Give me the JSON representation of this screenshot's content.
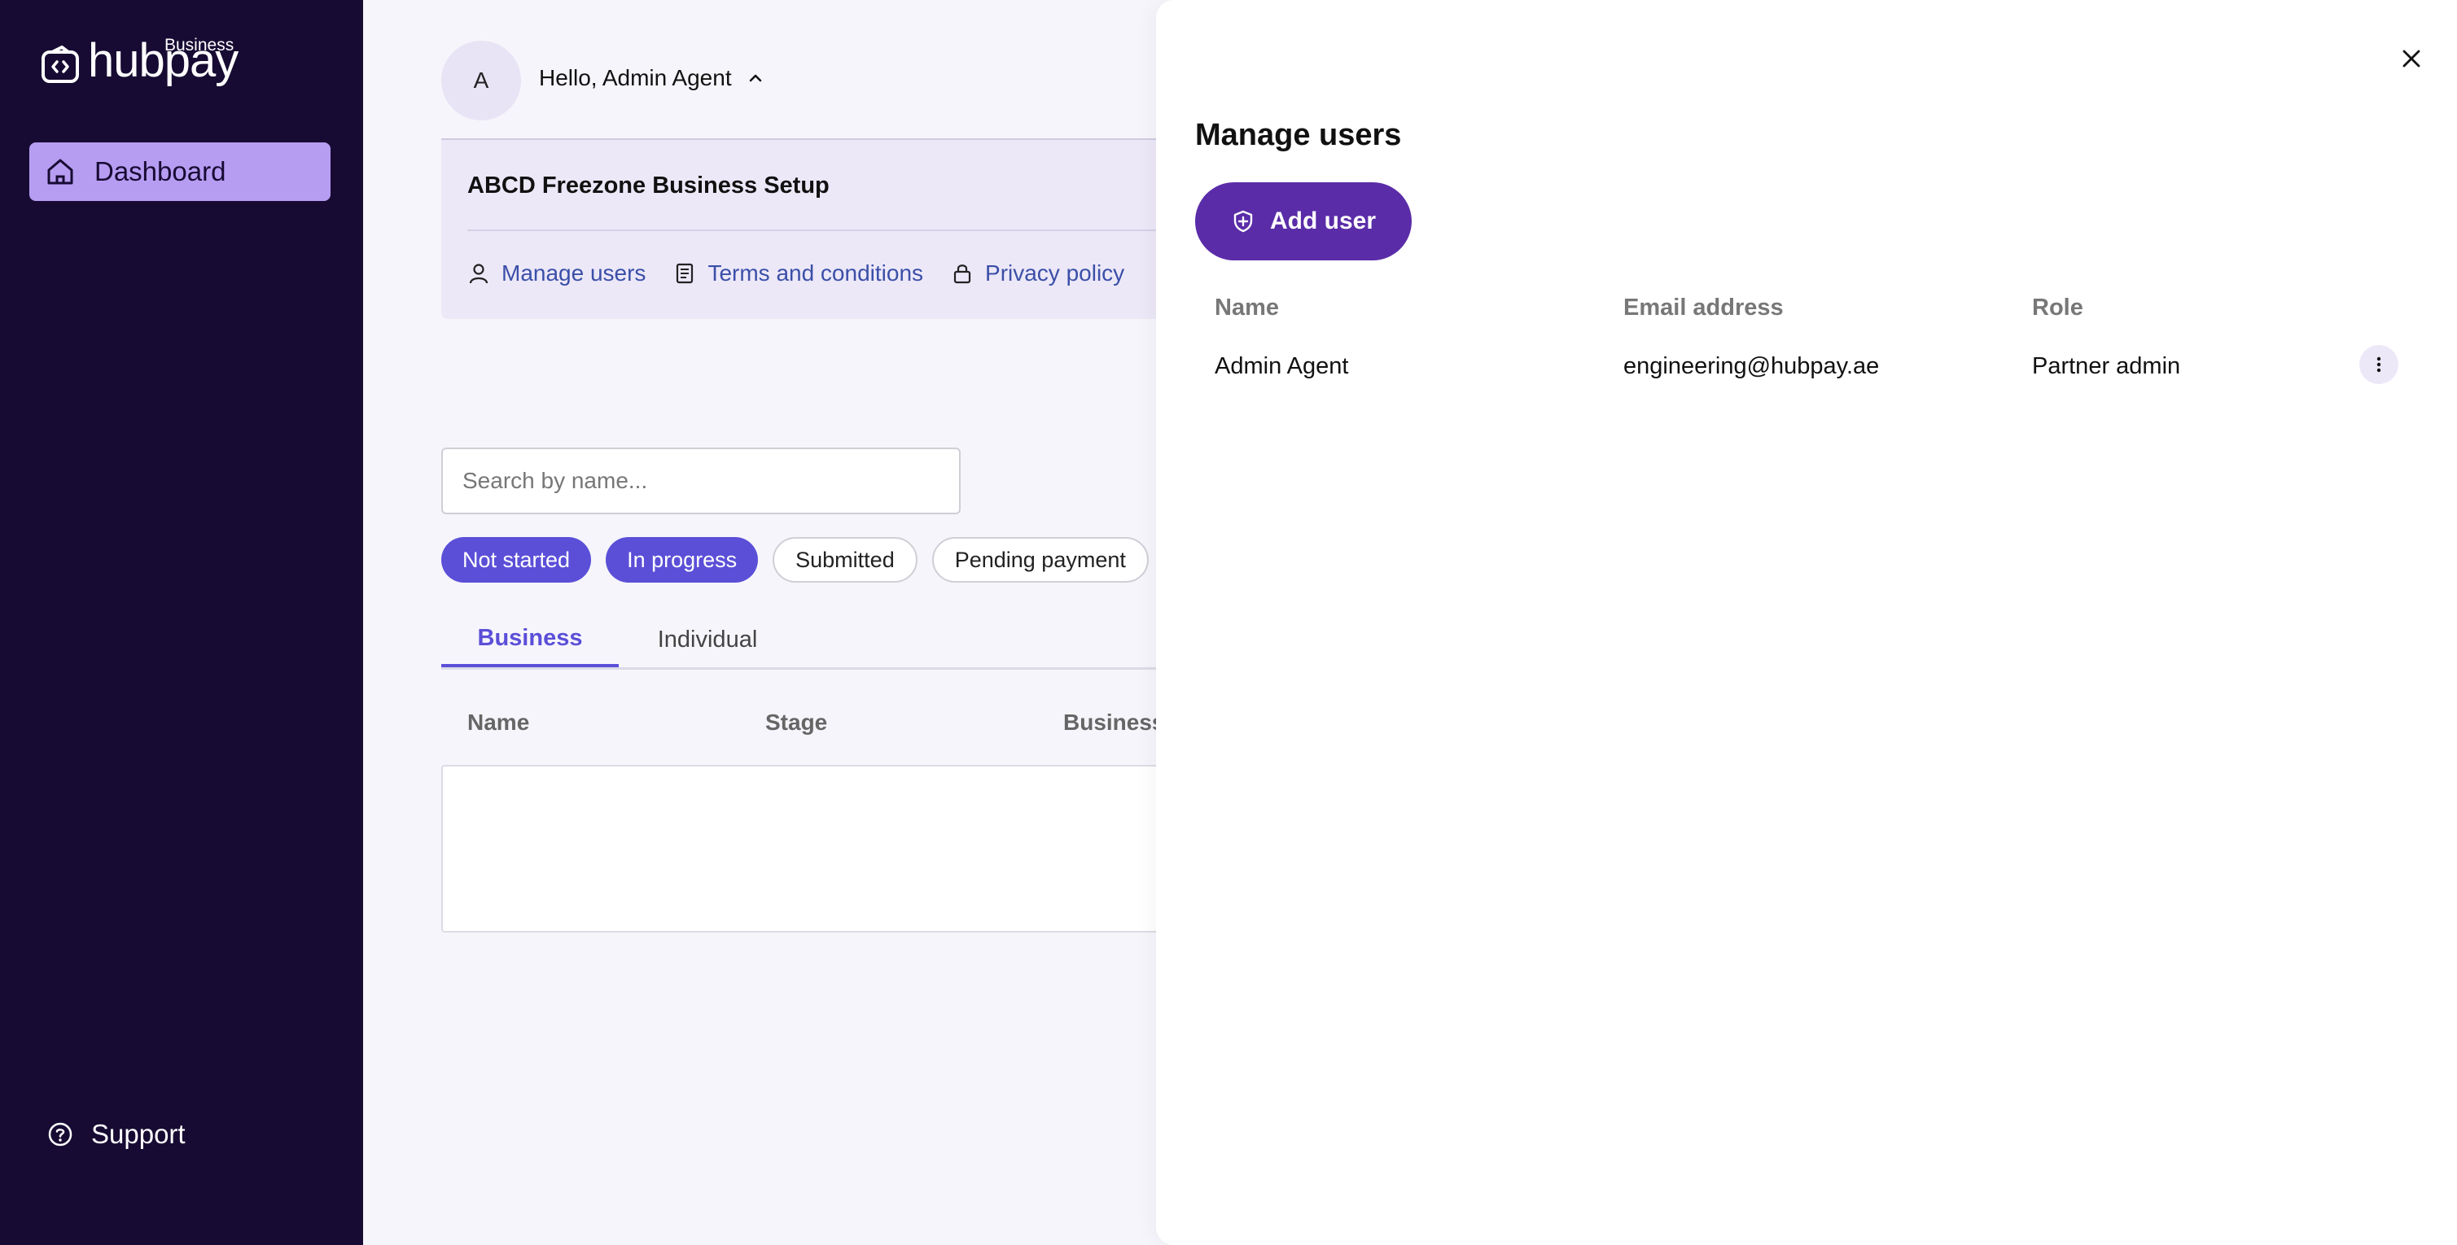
{
  "sidebar": {
    "logo_text": "hubpay",
    "logo_sub": "Business",
    "nav_dashboard": "Dashboard",
    "support": "Support"
  },
  "header": {
    "avatar_initial": "A",
    "greeting": "Hello, Admin Agent"
  },
  "company": {
    "name": "ABCD Freezone Business Setup",
    "links": [
      "Manage users",
      "Terms and conditions",
      "Privacy policy"
    ]
  },
  "search": {
    "placeholder": "Search by name..."
  },
  "filters": [
    {
      "label": "Not started",
      "active": true
    },
    {
      "label": "In progress",
      "active": true
    },
    {
      "label": "Submitted",
      "active": false
    },
    {
      "label": "Pending payment",
      "active": false
    }
  ],
  "tabs": [
    {
      "label": "Business",
      "active": true
    },
    {
      "label": "Individual",
      "active": false
    }
  ],
  "table": {
    "headers": [
      "Name",
      "Stage",
      "Business"
    ]
  },
  "drawer": {
    "title": "Manage users",
    "add_user_label": "Add user",
    "headers": [
      "Name",
      "Email address",
      "Role"
    ],
    "rows": [
      {
        "name": "Admin Agent",
        "email": "engineering@hubpay.ae",
        "role": "Partner admin"
      }
    ]
  },
  "colors": {
    "sidebar_bg": "#170b33",
    "nav_active": "#b79df2",
    "accent": "#5b4fd8",
    "add_user_btn": "#5a2ca8",
    "link": "#3b4fa8"
  }
}
